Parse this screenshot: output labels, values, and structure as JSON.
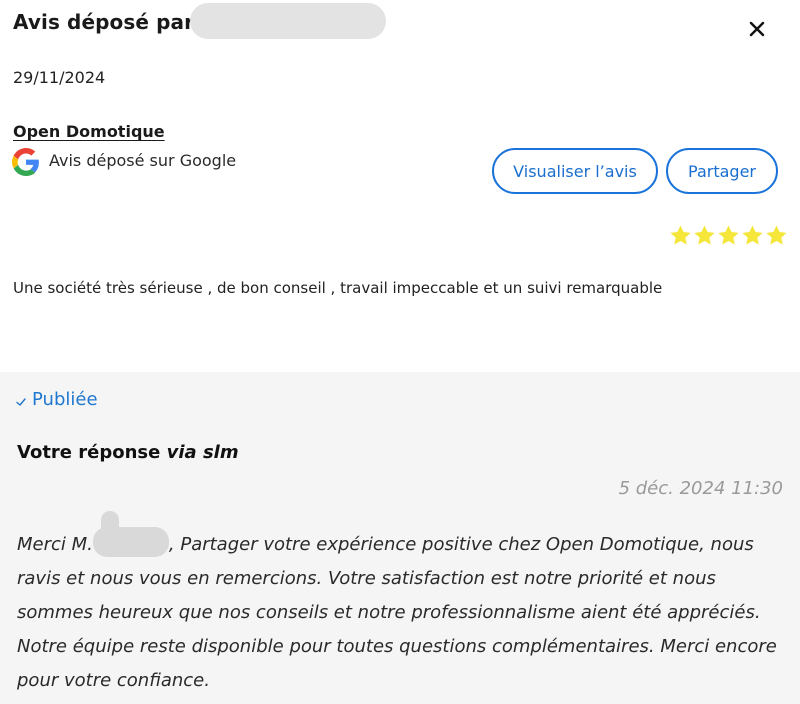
{
  "header": {
    "title": "Avis déposé par",
    "close_icon": "close-icon"
  },
  "review": {
    "date": "29/11/2024",
    "company": "Open Domotique",
    "source": "Avis déposé sur Google",
    "source_icon": "google-icon",
    "view_button": "Visualiser l’avis",
    "share_button": "Partager",
    "rating": 5,
    "rating_max": 5,
    "star_color": "#f5e63a",
    "text": "Une société très sérieuse , de bon conseil , travail impeccable et un suivi remarquable"
  },
  "response": {
    "status": "Publiée",
    "status_icon": "check-icon",
    "title_prefix": "Votre réponse",
    "title_via": "via slm",
    "date": "5 déc. 2024 11:30",
    "greeting": "Merci M.",
    "body": ", Partager votre expérience positive chez Open Domotique, nous ravis et nous vous en remercions. Votre satisfaction est notre priorité et nous sommes heureux que nos conseils et notre professionnalisme aient été appréciés. Notre équipe reste disponible pour toutes questions complémentaires. Merci encore pour votre confiance."
  },
  "colors": {
    "accent": "#1a73d9",
    "panel_bg": "#f5f5f5",
    "muted": "#9a9a9a"
  }
}
